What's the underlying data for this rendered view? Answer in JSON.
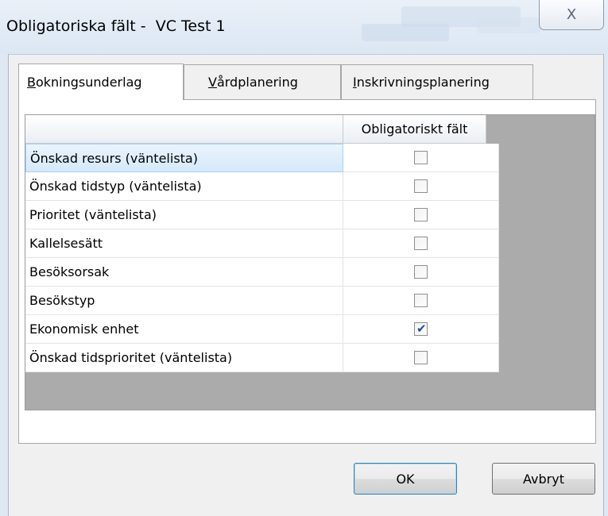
{
  "window": {
    "title": "Obligatoriska fält -  VC Test 1",
    "close_glyph": "X"
  },
  "tabs": [
    {
      "label": "Bokningsunderlag",
      "accel": "B",
      "rest": "okningsunderlag",
      "active": true
    },
    {
      "label": "Vårdplanering",
      "accel": "V",
      "rest": "årdplanering",
      "active": false
    },
    {
      "label": "Inskrivningsplanering",
      "accel": "I",
      "rest": "nskrivningsplanering",
      "active": false
    }
  ],
  "grid": {
    "columns": [
      "",
      "Obligatoriskt fält"
    ],
    "rows": [
      {
        "label": "Önskad resurs (väntelista)",
        "checked": false,
        "selected": true
      },
      {
        "label": "Önskad tidstyp (väntelista)",
        "checked": false,
        "selected": false
      },
      {
        "label": "Prioritet (väntelista)",
        "checked": false,
        "selected": false
      },
      {
        "label": "Kallelsesätt",
        "checked": false,
        "selected": false
      },
      {
        "label": "Besöksorsak",
        "checked": false,
        "selected": false
      },
      {
        "label": "Besökstyp",
        "checked": false,
        "selected": false
      },
      {
        "label": "Ekonomisk enhet",
        "checked": true,
        "selected": false
      },
      {
        "label": "Önskad tidsprioritet (väntelista)",
        "checked": false,
        "selected": false
      }
    ]
  },
  "buttons": {
    "ok": "OK",
    "cancel": "Avbryt"
  },
  "colors": {
    "title_bar": "#dce7f3",
    "selection": "#d5e9fa",
    "check_mark": "#1c4fa3"
  }
}
